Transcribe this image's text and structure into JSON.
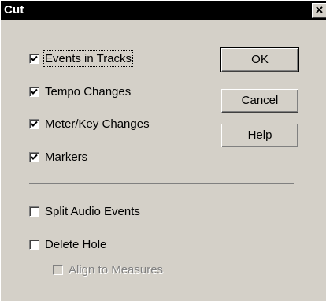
{
  "dialog": {
    "title": "Cut",
    "close_glyph": "×"
  },
  "options": [
    {
      "label": "Events in Tracks",
      "checked": true,
      "enabled": true
    },
    {
      "label": "Tempo Changes",
      "checked": true,
      "enabled": true
    },
    {
      "label": "Meter/Key Changes",
      "checked": true,
      "enabled": true
    },
    {
      "label": "Markers",
      "checked": true,
      "enabled": true
    },
    {
      "label": "Split Audio Events",
      "checked": false,
      "enabled": true
    },
    {
      "label": "Delete Hole",
      "checked": false,
      "enabled": true
    },
    {
      "label": "Align to Measures",
      "checked": false,
      "enabled": false
    }
  ],
  "buttons": {
    "ok": "OK",
    "cancel": "Cancel",
    "help": "Help"
  }
}
